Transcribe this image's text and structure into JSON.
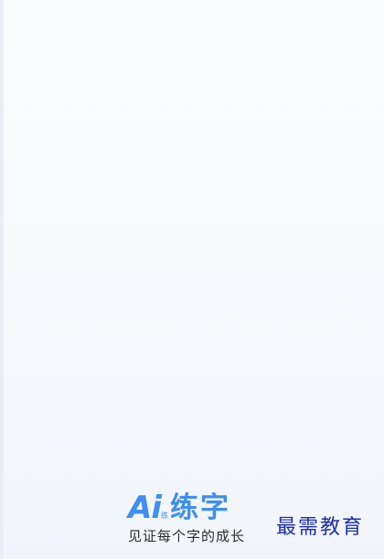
{
  "splash": {
    "logo_ai": "Ai",
    "logo_small": "练",
    "logo_name": "练字",
    "slogan": "见证每个字的成长"
  },
  "watermark": {
    "text": "最需教育"
  },
  "colors": {
    "brand_blue": "#3f8ef0",
    "watermark_blue": "#1d2fa8",
    "background_top": "#fbfcfe",
    "background_bottom": "#f1f5fb"
  }
}
